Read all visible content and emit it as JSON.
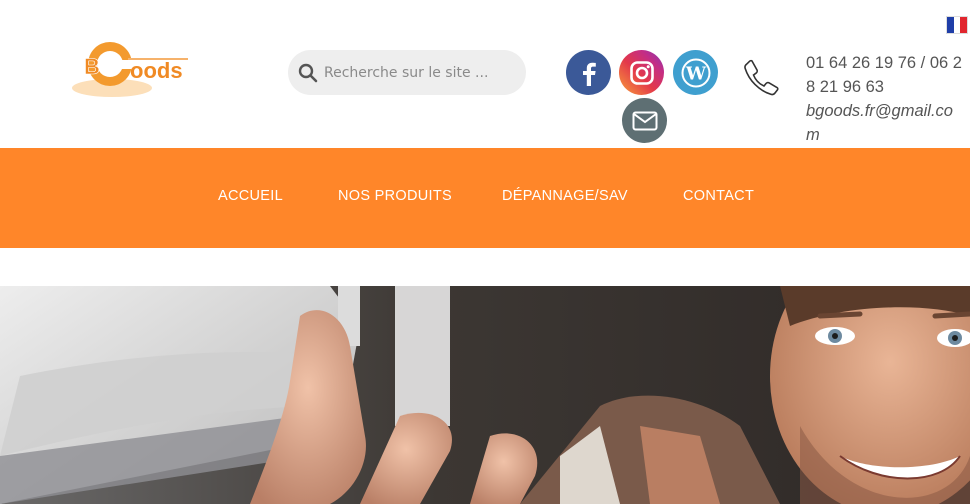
{
  "language": {
    "flag": "france-flag-icon"
  },
  "logo": {
    "text_b": "B",
    "text_rest": "oods",
    "brand_color": "#f08a24"
  },
  "search": {
    "placeholder": "Recherche sur le site ...",
    "icon": "search-icon"
  },
  "social": {
    "items": [
      {
        "name": "facebook",
        "icon": "facebook-icon",
        "color": "#3b5998"
      },
      {
        "name": "instagram",
        "icon": "instagram-icon",
        "color": "#e3384a"
      },
      {
        "name": "wordpress",
        "icon": "wordpress-icon",
        "color": "#3f9fcf"
      },
      {
        "name": "email",
        "icon": "envelope-icon",
        "color": "#5e6f73"
      }
    ]
  },
  "contact": {
    "phone": "01 64 26 19 76 / 06 28 21 96 63",
    "email": "bgoods.fr@gmail.com"
  },
  "nav": {
    "background": "#ff8629",
    "items": [
      "ACCUEIL",
      "NOS PRODUITS",
      "DÉPANNAGE/SAV",
      "CONTACT"
    ]
  },
  "hero": {
    "image": "man-with-air-conditioner-photo"
  }
}
